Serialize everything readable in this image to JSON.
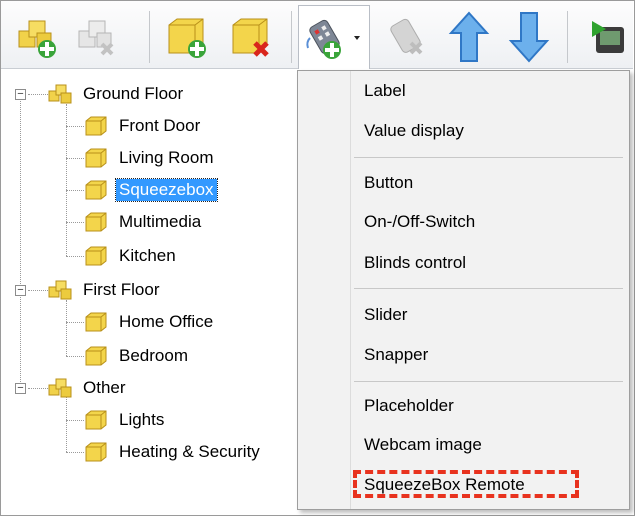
{
  "toolbar": {
    "buttons": [
      {
        "name": "add-building-icon"
      },
      {
        "name": "delete-building-icon"
      },
      {
        "name": "add-room-icon"
      },
      {
        "name": "delete-room-icon"
      },
      {
        "name": "add-control-icon"
      },
      {
        "name": "delete-control-icon"
      },
      {
        "name": "move-up-icon"
      },
      {
        "name": "move-down-icon"
      },
      {
        "name": "export-icon"
      }
    ]
  },
  "tree": {
    "groups": [
      {
        "label": "Ground Floor",
        "children": [
          "Front Door",
          "Living Room",
          "Squeezebox",
          "Multimedia",
          "Kitchen"
        ]
      },
      {
        "label": "First Floor",
        "children": [
          "Home Office",
          "Bedroom"
        ]
      },
      {
        "label": "Other",
        "children": [
          "Lights",
          "Heating & Security"
        ]
      }
    ],
    "selected": "Squeezebox"
  },
  "menu": {
    "items": [
      "Label",
      "Value display",
      "Button",
      "On-/Off-Switch",
      "Blinds control",
      "Slider",
      "Snapper",
      "Placeholder",
      "Webcam image",
      "SqueezeBox Remote"
    ]
  },
  "colors": {
    "selection": "#3399ff",
    "highlight": "#e8321e"
  }
}
